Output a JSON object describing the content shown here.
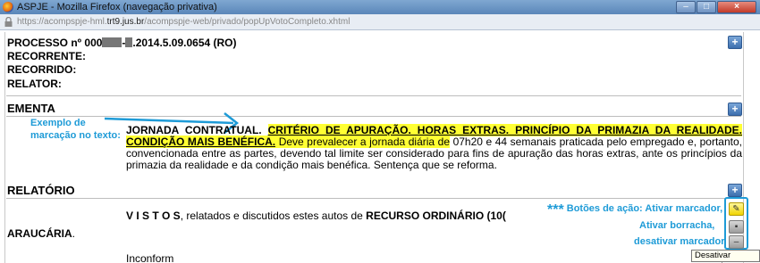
{
  "window": {
    "title": "ASPJE - Mozilla Firefox (navegação privativa)",
    "url_prefix": "https://acompspje-hml.",
    "url_domain": "trt9.jus.br",
    "url_path": "/acompspje-web/privado/popUpVotoCompleto.xhtml"
  },
  "header": {
    "processo_prefix": "PROCESSO nº 000",
    "processo_mid": "-",
    "processo_suffix": ".2014.5.09.0654 (RO)",
    "recorrente": "RECORRENTE:",
    "recorrido": "RECORRIDO:",
    "relator": "RELATOR:"
  },
  "ementa": {
    "title": "EMENTA",
    "example_label_1": "Exemplo de",
    "example_label_2": "marcação no texto:",
    "part1": "JORNADA CONTRATUAL. ",
    "part2": "CRITÉRIO DE APURAÇÃO. HORAS EXTRAS. PRINCÍPIO DA PRIMAZIA DA REALIDADE. CONDIÇÃO MAIS BENÉFICA.",
    "part3": " Deve prevalecer a jornada diária de",
    "part4": " 07h20 e 44 semanais praticada pelo empregado e, portanto, convencionada entre as partes, devendo tal limite ser considerado para fins de apuração das horas extras, ante os princípios da primazia da realidade e da condição mais benéfica. Sentença que se reforma."
  },
  "relatorio": {
    "title": "RELATÓRIO",
    "vistos": "V I S T O S",
    "line1_mid": ", relatados e discutidos estes autos de ",
    "line1_bold": "RECURSO ORDINÁRIO (10(",
    "araucaria": "ARAUCÁRIA",
    "araucaria_dot": ".",
    "inconform": "Inconform"
  },
  "annotations": {
    "line1_stars": "***",
    "line1": " Botões de ação: Ativar marcador,",
    "line2": "Ativar borracha,",
    "line3": "desativar marcador"
  },
  "tooltip": "Desativar marcador",
  "buttons": {
    "plus": "+",
    "marker": "✎",
    "eraser": "▪",
    "off": "–"
  },
  "colors": {
    "accent": "#1e9bd7",
    "highlight": "#ffff33"
  }
}
